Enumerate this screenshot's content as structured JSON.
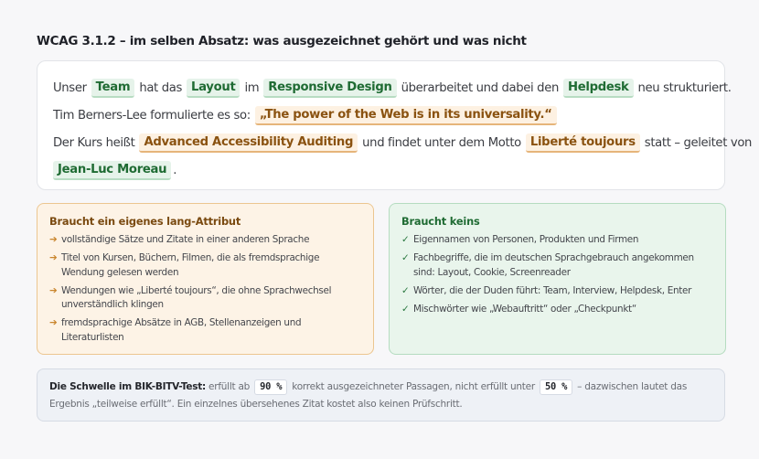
{
  "title": "WCAG 3.1.2 – im selben Absatz: was ausgezeichnet gehört und was nicht",
  "example": {
    "line1": {
      "t1": "Unser",
      "tag1": "Team",
      "t2": "hat das",
      "tag2": "Layout",
      "t3": "im",
      "tag3": "Responsive Design",
      "t4": "überarbeitet und dabei den",
      "tag4": "Helpdesk",
      "t5": "neu strukturiert."
    },
    "line2": {
      "t1": "Tim Berners-Lee formulierte es so:",
      "tag1": "„The power of the Web is in its universality.“"
    },
    "line3": {
      "t1": "Der Kurs heißt",
      "tag1": "Advanced Accessibility Auditing",
      "t2": "und findet unter dem Motto",
      "tag2": "Liberté toujours",
      "t3": "statt – geleitet von"
    },
    "line4": {
      "tag1": "Jean-Luc Moreau",
      "t1": "."
    }
  },
  "needs_lang": {
    "heading": "Braucht ein eigenes lang-Attribut",
    "marker": "➔",
    "items": [
      "vollständige Sätze und Zitate in einer anderen Sprache",
      "Titel von Kursen, Büchern, Filmen, die als fremdsprachige Wendung gelesen werden",
      "Wendungen wie „Liberté toujours“, die ohne Sprachwechsel unverständlich klingen",
      "fremdsprachige Absätze in AGB, Stellenanzeigen und Literaturlisten"
    ]
  },
  "no_lang": {
    "heading": "Braucht keins",
    "marker": "✓",
    "items": [
      "Eigennamen von Personen, Produkten und Firmen",
      "Fachbegriffe, die im deutschen Sprachgebrauch angekommen sind: Layout, Cookie, Screenreader",
      "Wörter, die der Duden führt: Team, Interview, Helpdesk, Enter",
      "Mischwörter wie „Webauftritt“ oder „Checkpunkt“"
    ]
  },
  "threshold": {
    "label": "Die Schwelle im BIK-BITV-Test:",
    "t1": "erfüllt ab",
    "value1": "90 %",
    "t2": "korrekt ausgezeichneter Passagen, nicht erfüllt unter",
    "value2": "50 %",
    "t3": "– dazwischen lautet das Ergebnis „teilweise erfüllt“. Ein einzelnes übersehenes Zitat kostet also keinen Prüfschritt."
  },
  "colors": {
    "foreign_tag": "#8a5210",
    "native_tag": "#1f6b33",
    "needs_box": "#fdf3e6",
    "no_box": "#e9f5ec"
  }
}
